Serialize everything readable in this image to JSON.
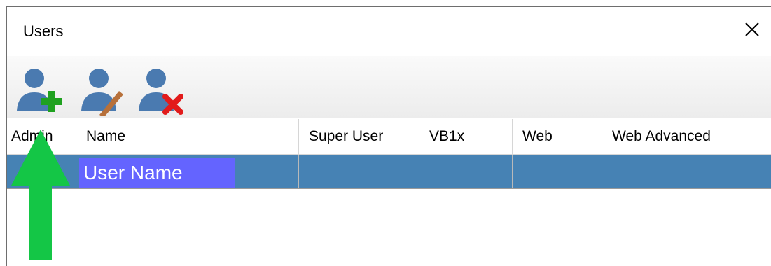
{
  "window": {
    "title": "Users"
  },
  "toolbar": {
    "buttons": [
      {
        "name": "add-user",
        "icon": "user-add-icon"
      },
      {
        "name": "edit-user",
        "icon": "user-edit-icon"
      },
      {
        "name": "delete-user",
        "icon": "user-delete-icon"
      }
    ]
  },
  "grid": {
    "columns": [
      "Admin",
      "Name",
      "Super User",
      "VB1x",
      "Web",
      "Web Advanced"
    ],
    "rows": [
      {
        "admin": "",
        "name": "User Name",
        "super_user": "",
        "vb1x": "",
        "web": "",
        "web_advanced": ""
      }
    ]
  },
  "colors": {
    "selected_row": "#4682b4",
    "edit_cell": "#6464ff",
    "user_icon": "#4a7ab0",
    "add_badge": "#1fa11f",
    "delete_badge": "#e21b1b",
    "edit_pencil": "#b7703a",
    "annotation_arrow": "#14c646"
  }
}
